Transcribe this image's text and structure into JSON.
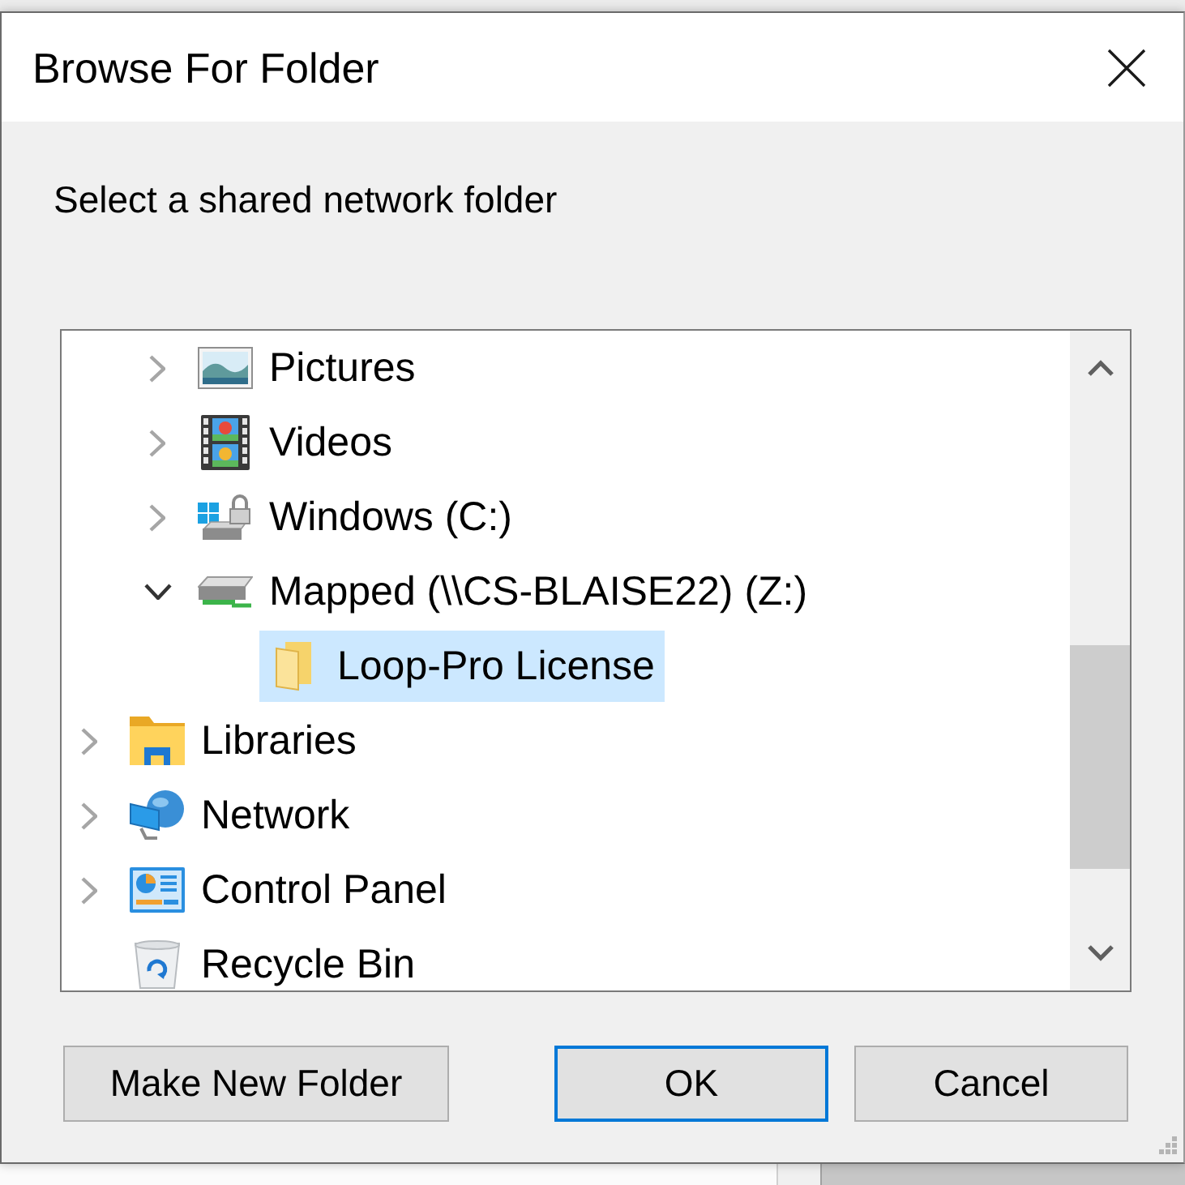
{
  "window": {
    "title": "Browse For Folder"
  },
  "instruction": "Select a shared network folder",
  "tree": {
    "items": [
      {
        "children": [
          {
            "label": "Pictures",
            "kind": "pictures",
            "expandable": true,
            "expanded": false,
            "selected": false
          },
          {
            "label": "Videos",
            "kind": "videos",
            "expandable": true,
            "expanded": false,
            "selected": false
          },
          {
            "label": "Windows (C:)",
            "kind": "system-drive",
            "expandable": true,
            "expanded": false,
            "selected": false
          },
          {
            "label": "Mapped (\\\\CS-BLAISE22) (Z:)",
            "kind": "network-drive",
            "expandable": true,
            "expanded": true,
            "selected": false,
            "children": [
              {
                "label": "Loop-Pro License",
                "kind": "folder",
                "expandable": false,
                "selected": true
              }
            ]
          }
        ]
      },
      {
        "label": "Libraries",
        "kind": "libraries",
        "expandable": true,
        "expanded": false,
        "selected": false
      },
      {
        "label": "Network",
        "kind": "network",
        "expandable": true,
        "expanded": false,
        "selected": false
      },
      {
        "label": "Control Panel",
        "kind": "control-panel",
        "expandable": true,
        "expanded": false,
        "selected": false
      },
      {
        "label": "Recycle Bin",
        "kind": "recycle-bin",
        "expandable": false,
        "selected": false
      }
    ]
  },
  "buttons": [
    {
      "label": "Make New Folder",
      "default": false
    },
    {
      "label": "OK",
      "default": true
    },
    {
      "label": "Cancel",
      "default": false
    }
  ]
}
